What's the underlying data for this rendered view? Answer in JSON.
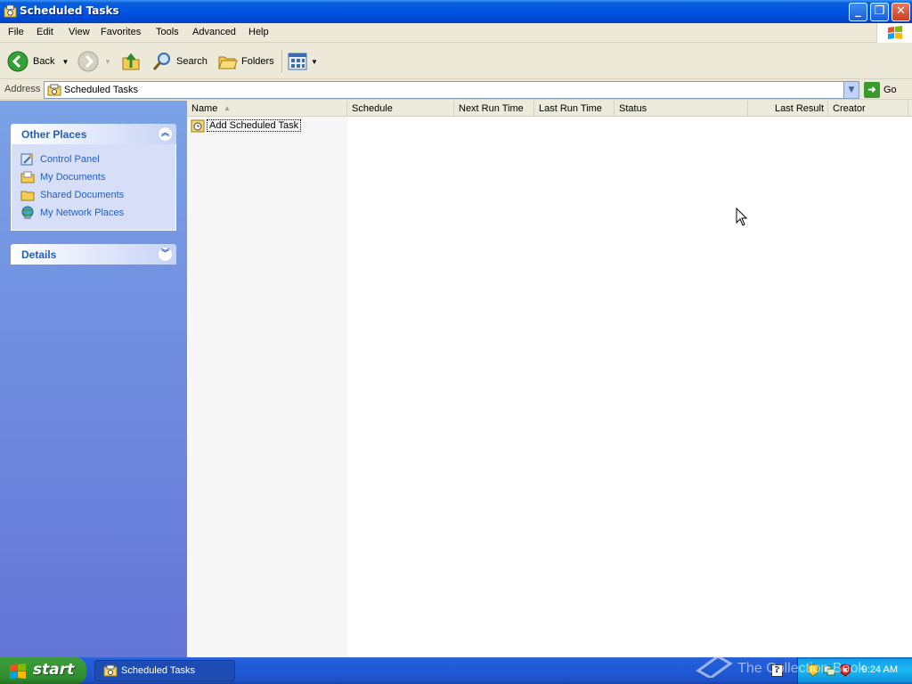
{
  "window": {
    "title": "Scheduled Tasks"
  },
  "menu": [
    "File",
    "Edit",
    "View",
    "Favorites",
    "Tools",
    "Advanced",
    "Help"
  ],
  "toolbar": {
    "back_label": "Back",
    "search_label": "Search",
    "folders_label": "Folders"
  },
  "address": {
    "label": "Address",
    "value": "Scheduled Tasks",
    "go_label": "Go"
  },
  "sidebar": {
    "other_places": {
      "title": "Other Places",
      "items": [
        {
          "label": "Control Panel",
          "icon": "control-panel-icon"
        },
        {
          "label": "My Documents",
          "icon": "my-documents-icon"
        },
        {
          "label": "Shared Documents",
          "icon": "folder-icon"
        },
        {
          "label": "My Network Places",
          "icon": "network-places-icon"
        }
      ]
    },
    "details": {
      "title": "Details"
    }
  },
  "list": {
    "columns": [
      "Name",
      "Schedule",
      "Next Run Time",
      "Last Run Time",
      "Status",
      "Last Result",
      "Creator"
    ],
    "items": [
      {
        "name": "Add Scheduled Task"
      }
    ]
  },
  "taskbar": {
    "start_label": "start",
    "task_label": "Scheduled Tasks",
    "clock": "9:24 AM"
  },
  "watermark": "The Collection Book",
  "colors": {
    "titlebar": "#0054e3",
    "sidebar": "#6375d6",
    "start": "#3a9a3a",
    "link": "#215dc6"
  }
}
